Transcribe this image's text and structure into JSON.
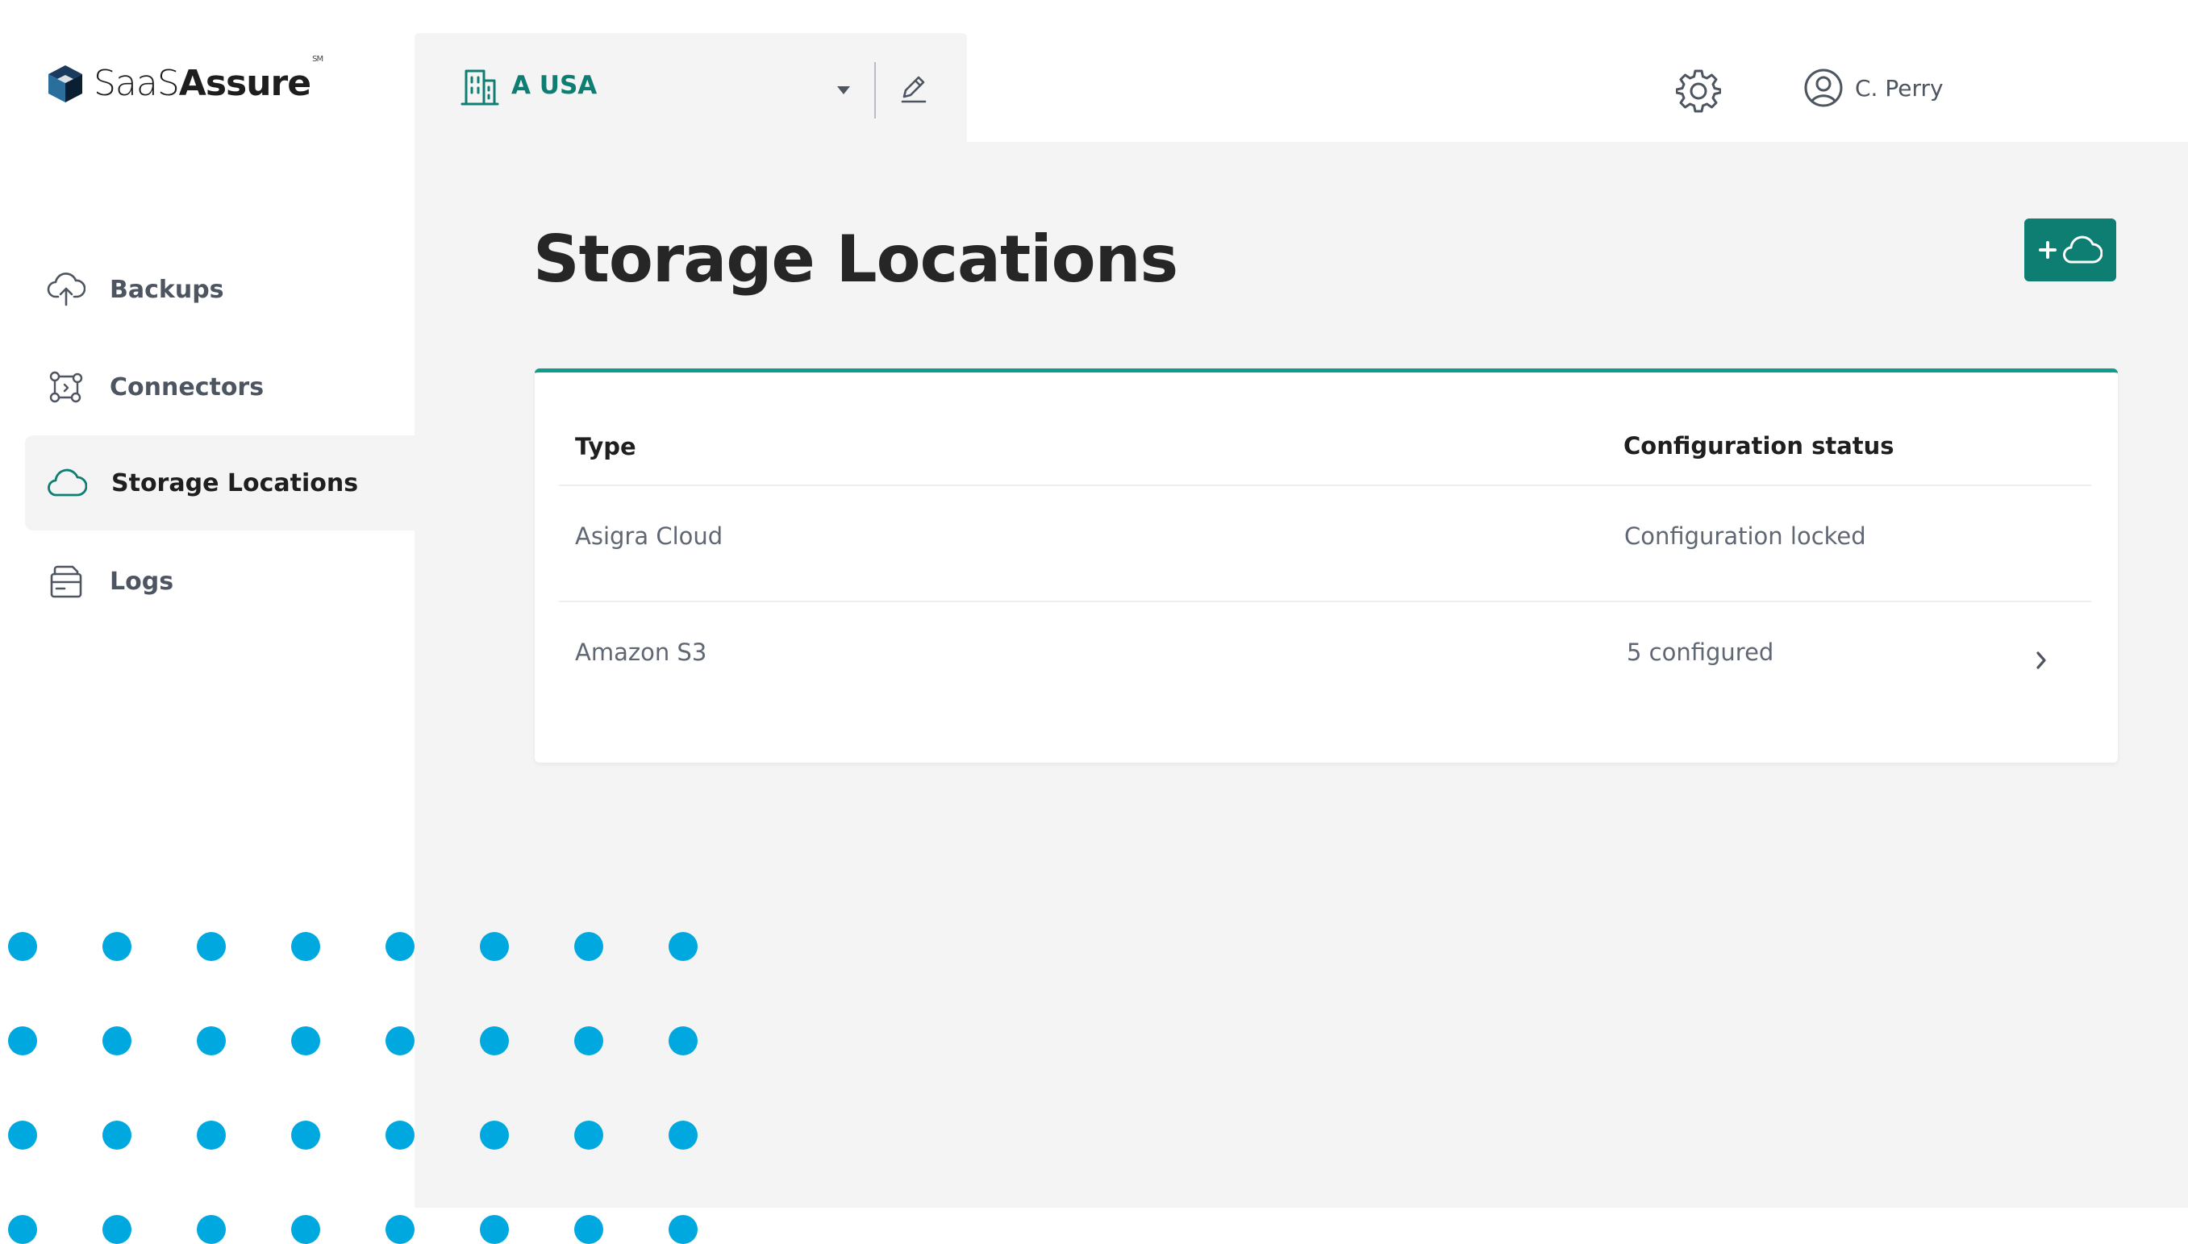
{
  "brand": {
    "logo_light": "SaaS",
    "logo_bold": "Assure",
    "logo_mark": "SM"
  },
  "sidebar": {
    "items": [
      {
        "label": "Backups",
        "icon": "cloud-upload-icon",
        "active": false
      },
      {
        "label": "Connectors",
        "icon": "connectors-icon",
        "active": false
      },
      {
        "label": "Storage Locations",
        "icon": "cloud-icon",
        "active": true
      },
      {
        "label": "Logs",
        "icon": "logs-icon",
        "active": false
      }
    ]
  },
  "header": {
    "tenant": {
      "name": "A USA",
      "icon": "building-icon"
    },
    "settings_icon": "gear-icon",
    "user": {
      "name": "C. Perry",
      "icon": "user-circle-icon"
    }
  },
  "main": {
    "title": "Storage Locations",
    "add_button_icon": "add-cloud-icon",
    "table": {
      "columns": [
        "Type",
        "Configuration status"
      ],
      "rows": [
        {
          "type": "Asigra Cloud",
          "status": "Configuration locked",
          "has_chevron": false
        },
        {
          "type": "Amazon S3",
          "status": "5 configured",
          "has_chevron": true
        }
      ]
    }
  },
  "colors": {
    "accent": "#0e7d72",
    "card_border": "#0e9c8c",
    "content_bg": "#f4f4f4",
    "dot": "#00a8e0"
  }
}
